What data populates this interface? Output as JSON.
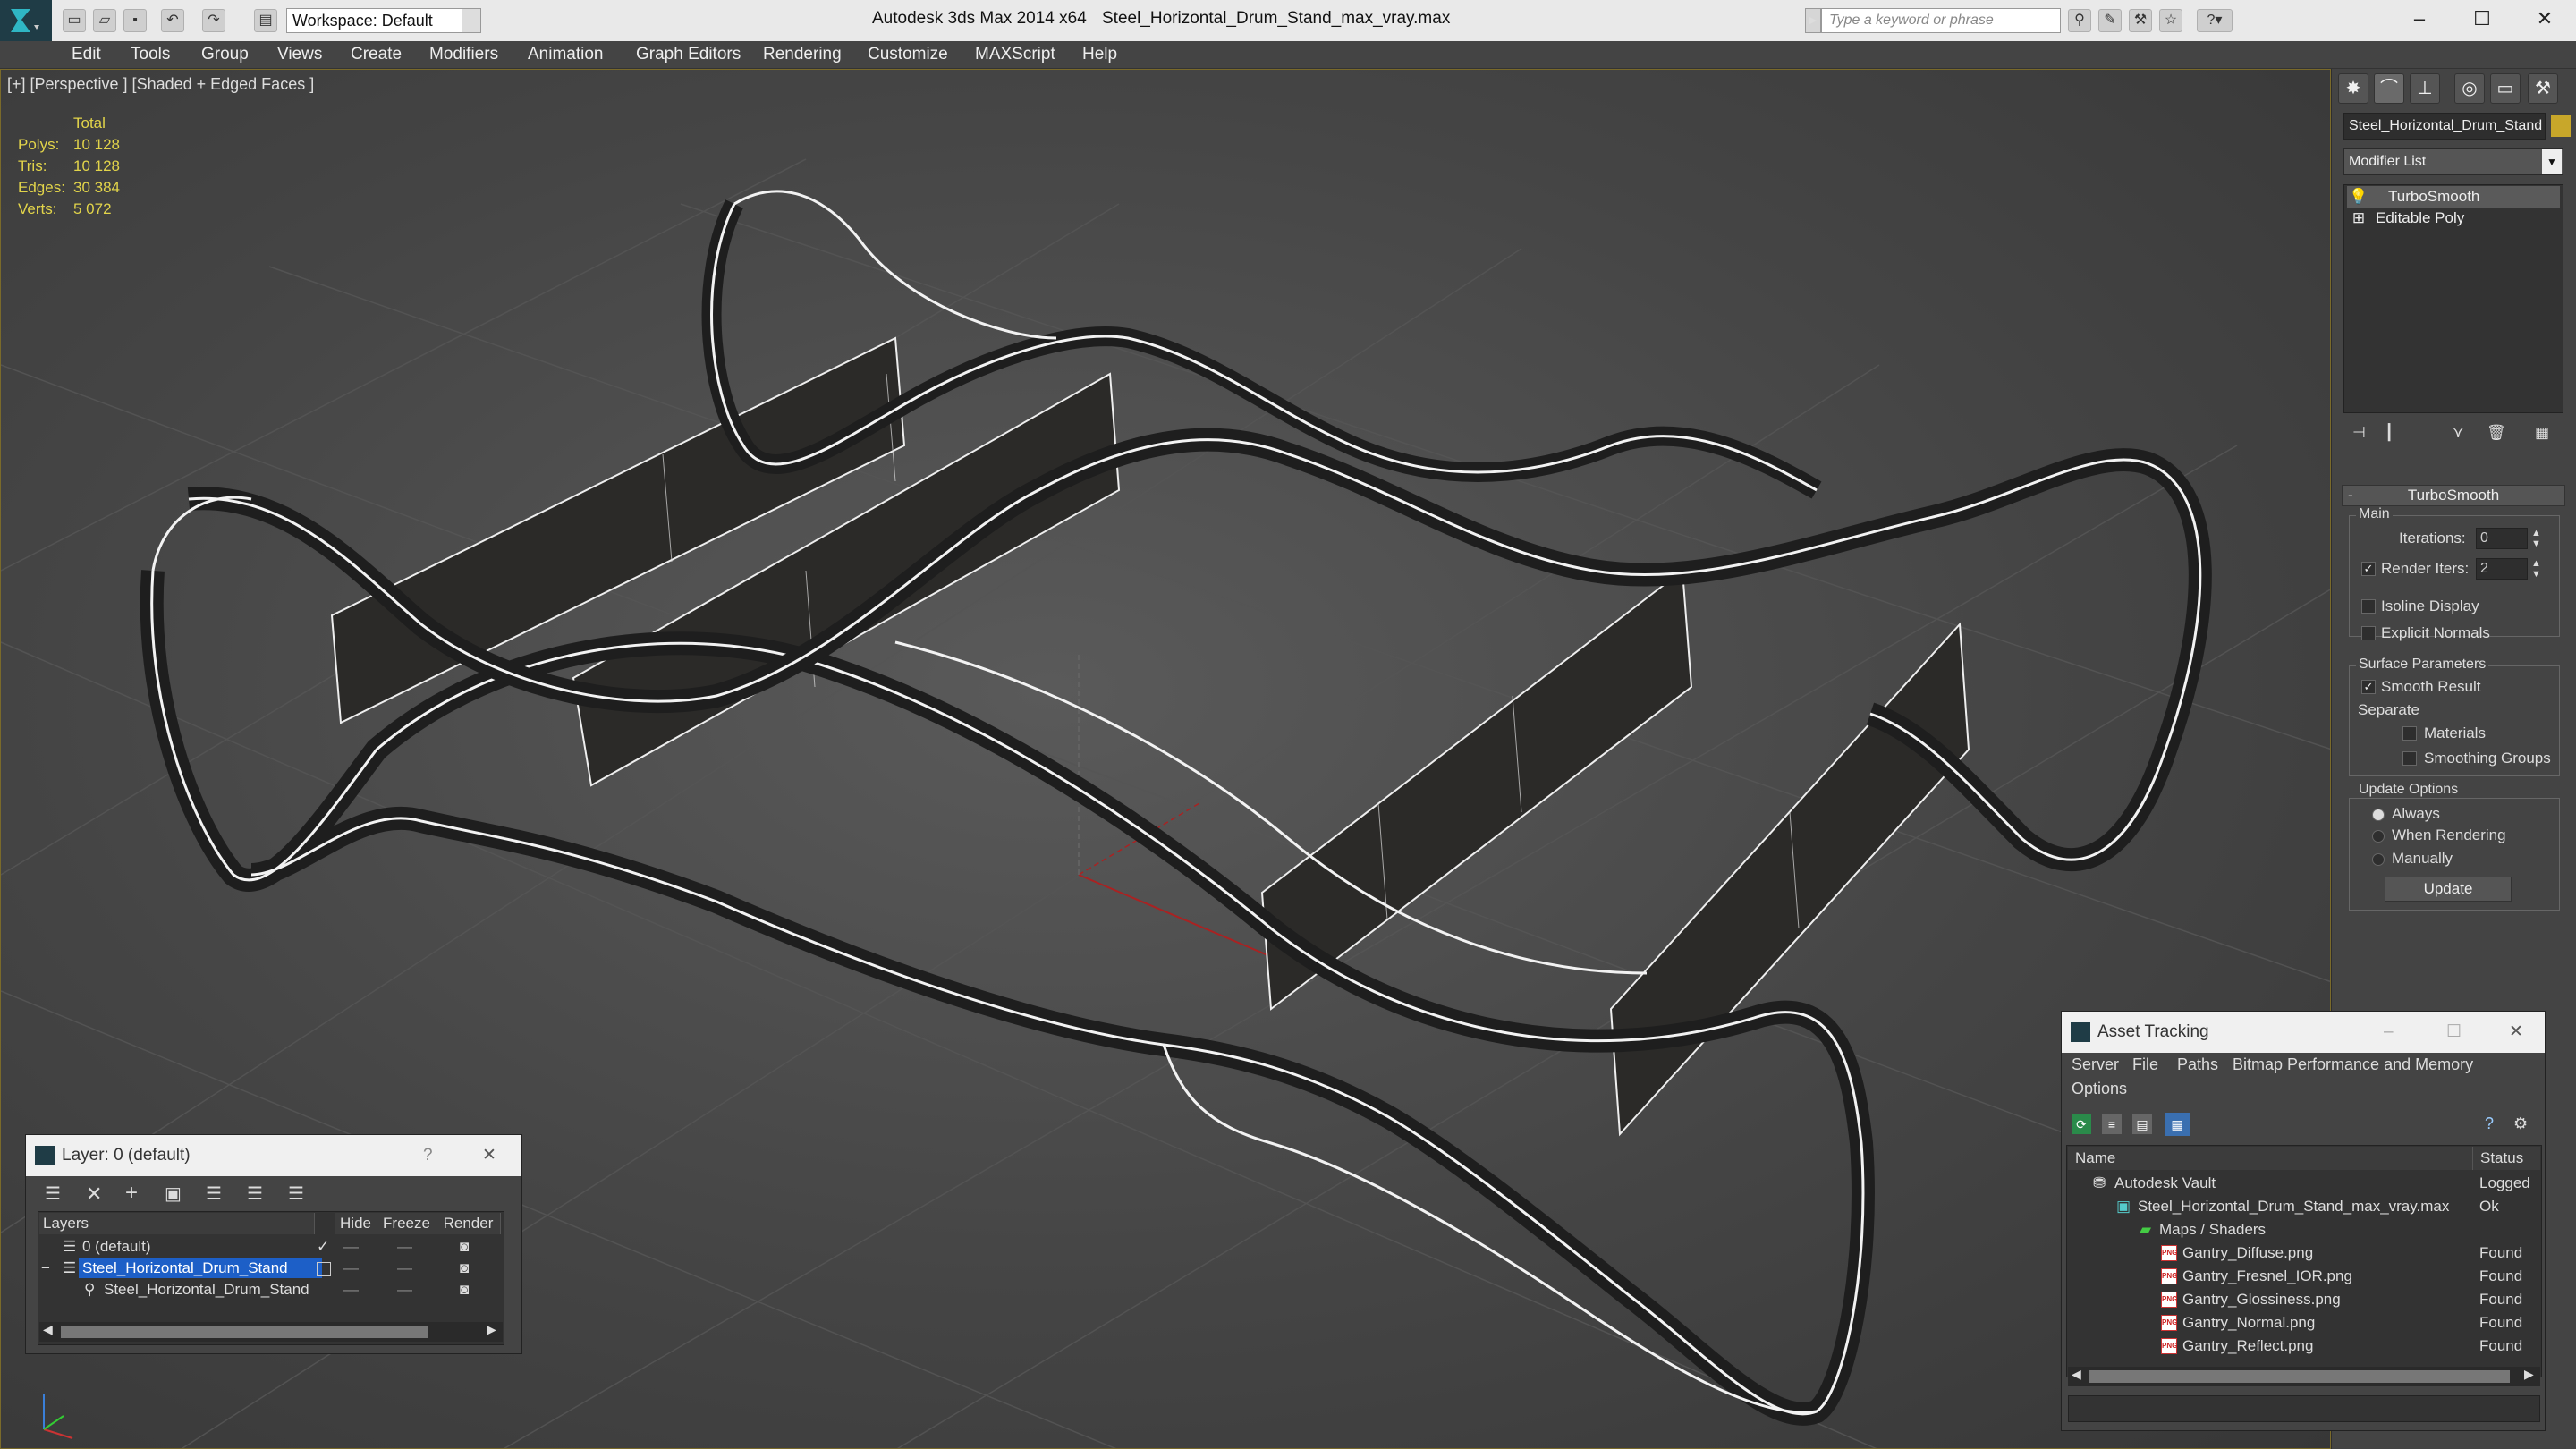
{
  "titlebar": {
    "workspace": "Workspace: Default",
    "app_title": "Autodesk 3ds Max  2014 x64",
    "file_title": "Steel_Horizontal_Drum_Stand_max_vray.max",
    "search_placeholder": "Type a keyword or phrase"
  },
  "menu": [
    "Edit",
    "Tools",
    "Group",
    "Views",
    "Create",
    "Modifiers",
    "Animation",
    "Graph Editors",
    "Rendering",
    "Customize",
    "MAXScript",
    "Help"
  ],
  "viewport": {
    "label": "[+] [Perspective ] [Shaded + Edged Faces ]",
    "stats_header": "Total",
    "stats": [
      {
        "label": "Polys:",
        "value": "10 128"
      },
      {
        "label": "Tris:",
        "value": "10 128"
      },
      {
        "label": "Edges:",
        "value": "30 384"
      },
      {
        "label": "Verts:",
        "value": "5 072"
      }
    ]
  },
  "command_panel": {
    "object_name": "Steel_Horizontal_Drum_Stand",
    "object_color": "#c8a72a",
    "modifier_list": "Modifier List",
    "stack": [
      "TurboSmooth",
      "Editable Poly"
    ],
    "rollout_title": "TurboSmooth",
    "main_group": "Main",
    "iterations_label": "Iterations:",
    "iterations_value": "0",
    "render_iters_label": "Render Iters:",
    "render_iters_value": "2",
    "isoline_label": "Isoline Display",
    "explicit_normals_label": "Explicit Normals",
    "surface_group": "Surface Parameters",
    "smooth_result_label": "Smooth Result",
    "separate_label": "Separate",
    "materials_label": "Materials",
    "smoothing_groups_label": "Smoothing Groups",
    "update_group": "Update Options",
    "always_label": "Always",
    "when_rendering_label": "When Rendering",
    "manually_label": "Manually",
    "update_button": "Update"
  },
  "layer_dialog": {
    "title": "Layer: 0 (default)",
    "help": "?",
    "columns": [
      "Layers",
      "Hide",
      "Freeze",
      "Render"
    ],
    "rows": [
      {
        "name": "0 (default)",
        "selected": false,
        "indent": 0
      },
      {
        "name": "Steel_Horizontal_Drum_Stand",
        "selected": true,
        "indent": 0
      },
      {
        "name": "Steel_Horizontal_Drum_Stand",
        "selected": false,
        "indent": 1
      }
    ]
  },
  "asset_dialog": {
    "title": "Asset Tracking",
    "menu": [
      "Server",
      "File",
      "Paths",
      "Bitmap Performance and Memory",
      "Options"
    ],
    "columns": [
      "Name",
      "Status"
    ],
    "rows": [
      {
        "name": "Autodesk Vault",
        "status": "Logged",
        "indent": 0,
        "icon": "vault"
      },
      {
        "name": "Steel_Horizontal_Drum_Stand_max_vray.max",
        "status": "Ok",
        "indent": 1,
        "icon": "max"
      },
      {
        "name": "Maps / Shaders",
        "status": "",
        "indent": 2,
        "icon": "maps"
      },
      {
        "name": "Gantry_Diffuse.png",
        "status": "Found",
        "indent": 3,
        "icon": "png"
      },
      {
        "name": "Gantry_Fresnel_IOR.png",
        "status": "Found",
        "indent": 3,
        "icon": "png"
      },
      {
        "name": "Gantry_Glossiness.png",
        "status": "Found",
        "indent": 3,
        "icon": "png"
      },
      {
        "name": "Gantry_Normal.png",
        "status": "Found",
        "indent": 3,
        "icon": "png"
      },
      {
        "name": "Gantry_Reflect.png",
        "status": "Found",
        "indent": 3,
        "icon": "png"
      }
    ],
    "png_tag": "PNG"
  }
}
